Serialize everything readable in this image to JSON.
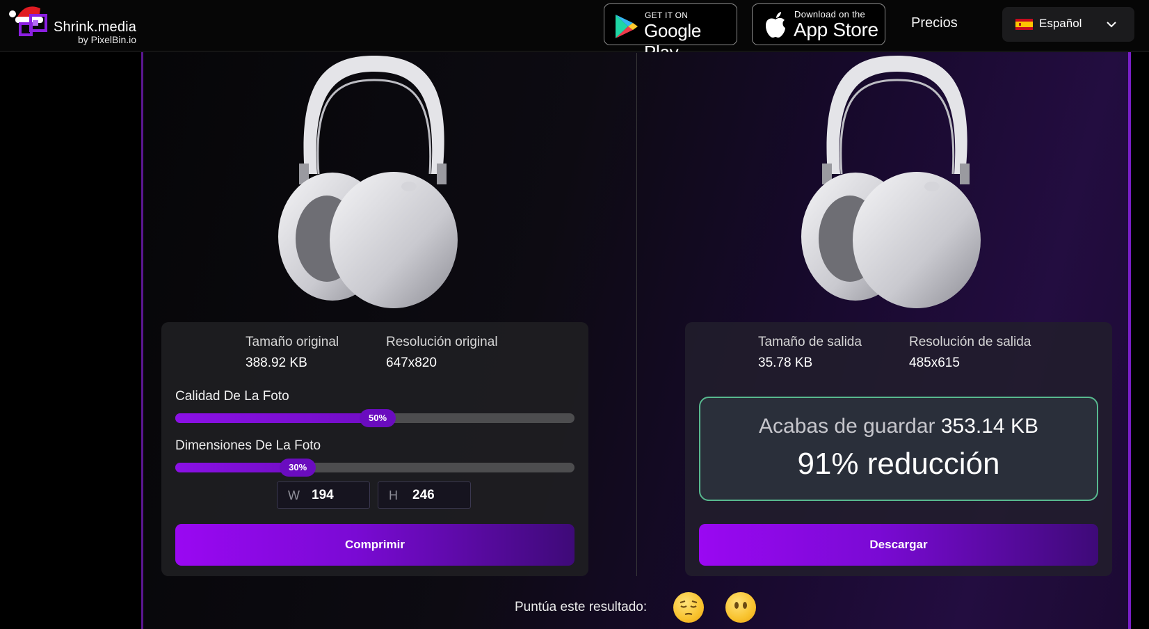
{
  "header": {
    "logo": {
      "name": "Shrink.media",
      "byline": "by PixelBin.io"
    },
    "google_play": {
      "small": "GET IT ON",
      "big": "Google Play"
    },
    "app_store": {
      "small": "Download on the",
      "big": "App Store"
    },
    "pricing_label": "Precios",
    "language": {
      "selected": "Español",
      "icon": "spain-flag-icon"
    }
  },
  "original": {
    "size_label": "Tamaño original",
    "size_value": "388.92 KB",
    "resolution_label": "Resolución original",
    "resolution_value": "647x820",
    "quality": {
      "title": "Calidad De La Foto",
      "value": "50%",
      "fraction": 0.5
    },
    "dimensions": {
      "title": "Dimensiones De La Foto",
      "value": "30%",
      "fraction": 0.3
    },
    "width_prefix": "W",
    "width_value": "194",
    "height_prefix": "H",
    "height_value": "246",
    "compress_button": "Comprimir"
  },
  "output": {
    "size_label": "Tamaño de salida",
    "size_value": "35.78 KB",
    "resolution_label": "Resolución de salida",
    "resolution_value": "485x615",
    "saved_prefix": "Acabas de guardar",
    "saved_amount": "353.14 KB",
    "reduction": "91% reducción",
    "download_button": "Descargar"
  },
  "rating": {
    "label": "Puntúa este resultado:",
    "options": [
      "pensive-face-icon",
      "face-without-mouth-icon"
    ]
  },
  "colors": {
    "accent": "#8b10e6",
    "success_border": "#58b98f"
  }
}
